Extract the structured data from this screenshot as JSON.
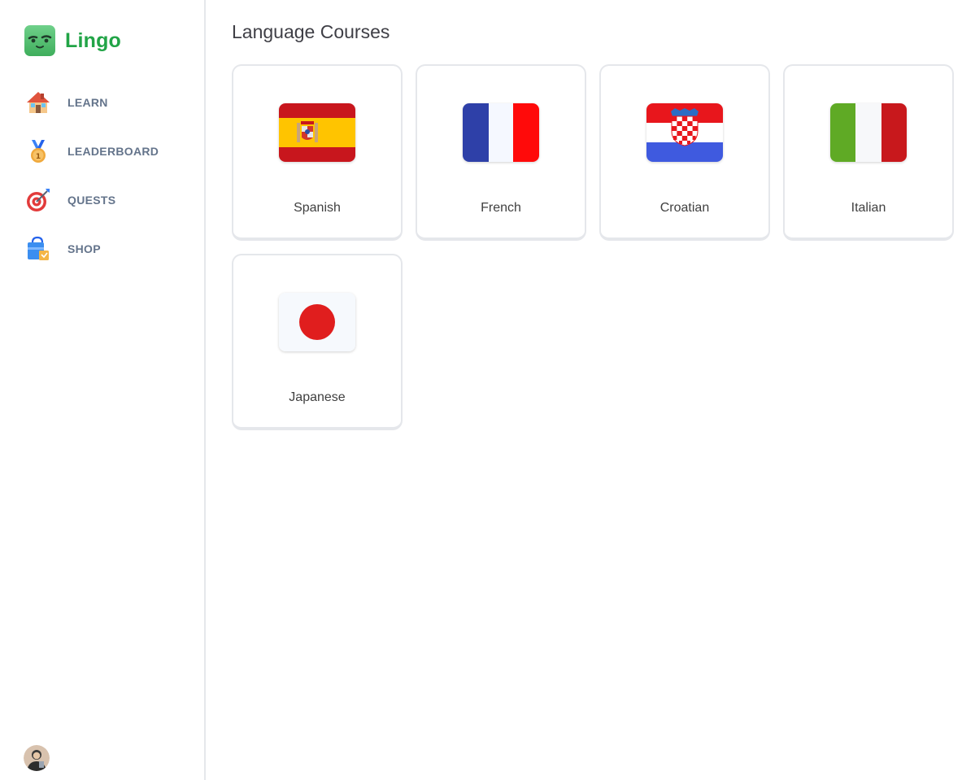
{
  "app": {
    "name": "Lingo"
  },
  "sidebar": {
    "items": [
      {
        "label": "LEARN",
        "icon": "house-icon"
      },
      {
        "label": "LEADERBOARD",
        "icon": "medal-icon"
      },
      {
        "label": "QUESTS",
        "icon": "target-icon"
      },
      {
        "label": "SHOP",
        "icon": "shopping-bag-icon"
      }
    ]
  },
  "main": {
    "title": "Language Courses",
    "courses": [
      {
        "label": "Spanish",
        "flag": "spain-flag-icon"
      },
      {
        "label": "French",
        "flag": "france-flag-icon"
      },
      {
        "label": "Croatian",
        "flag": "croatia-flag-icon"
      },
      {
        "label": "Italian",
        "flag": "italy-flag-icon"
      },
      {
        "label": "Japanese",
        "flag": "japan-flag-icon"
      }
    ]
  },
  "colors": {
    "brand": "#22a447",
    "nav_text": "#64748b",
    "border": "#e5e7eb"
  }
}
